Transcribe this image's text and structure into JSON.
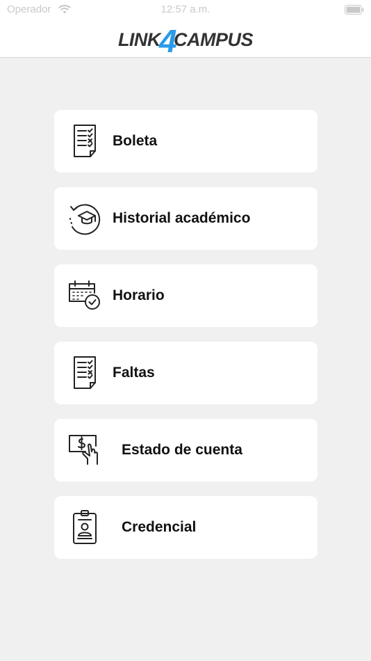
{
  "status_bar": {
    "carrier": "Operador",
    "time": "12:57 a.m."
  },
  "header": {
    "logo_left": "LINK",
    "logo_number": "4",
    "logo_right": "CAMPUS",
    "accent_color": "#2a9ae8"
  },
  "menu": {
    "items": [
      {
        "label": "Boleta",
        "icon": "report-card-icon"
      },
      {
        "label": "Historial académico",
        "icon": "graduation-history-icon"
      },
      {
        "label": "Horario",
        "icon": "calendar-check-icon"
      },
      {
        "label": "Faltas",
        "icon": "checklist-icon"
      },
      {
        "label": "Estado de cuenta",
        "icon": "payment-card-icon"
      },
      {
        "label": "Credencial",
        "icon": "id-badge-icon"
      }
    ]
  }
}
